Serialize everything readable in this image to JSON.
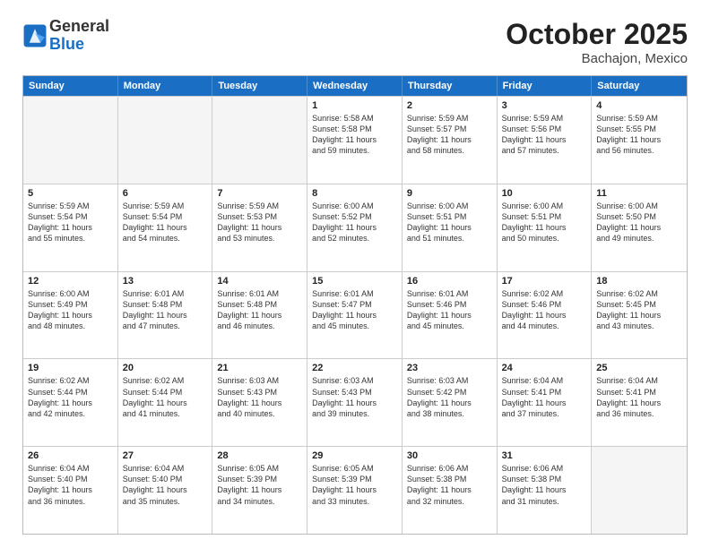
{
  "header": {
    "logo_general": "General",
    "logo_blue": "Blue",
    "month_title": "October 2025",
    "location": "Bachajon, Mexico"
  },
  "weekdays": [
    "Sunday",
    "Monday",
    "Tuesday",
    "Wednesday",
    "Thursday",
    "Friday",
    "Saturday"
  ],
  "rows": [
    [
      {
        "day": "",
        "lines": [],
        "empty": true
      },
      {
        "day": "",
        "lines": [],
        "empty": true
      },
      {
        "day": "",
        "lines": [],
        "empty": true
      },
      {
        "day": "1",
        "lines": [
          "Sunrise: 5:58 AM",
          "Sunset: 5:58 PM",
          "Daylight: 11 hours",
          "and 59 minutes."
        ]
      },
      {
        "day": "2",
        "lines": [
          "Sunrise: 5:59 AM",
          "Sunset: 5:57 PM",
          "Daylight: 11 hours",
          "and 58 minutes."
        ]
      },
      {
        "day": "3",
        "lines": [
          "Sunrise: 5:59 AM",
          "Sunset: 5:56 PM",
          "Daylight: 11 hours",
          "and 57 minutes."
        ]
      },
      {
        "day": "4",
        "lines": [
          "Sunrise: 5:59 AM",
          "Sunset: 5:55 PM",
          "Daylight: 11 hours",
          "and 56 minutes."
        ]
      }
    ],
    [
      {
        "day": "5",
        "lines": [
          "Sunrise: 5:59 AM",
          "Sunset: 5:54 PM",
          "Daylight: 11 hours",
          "and 55 minutes."
        ]
      },
      {
        "day": "6",
        "lines": [
          "Sunrise: 5:59 AM",
          "Sunset: 5:54 PM",
          "Daylight: 11 hours",
          "and 54 minutes."
        ]
      },
      {
        "day": "7",
        "lines": [
          "Sunrise: 5:59 AM",
          "Sunset: 5:53 PM",
          "Daylight: 11 hours",
          "and 53 minutes."
        ]
      },
      {
        "day": "8",
        "lines": [
          "Sunrise: 6:00 AM",
          "Sunset: 5:52 PM",
          "Daylight: 11 hours",
          "and 52 minutes."
        ]
      },
      {
        "day": "9",
        "lines": [
          "Sunrise: 6:00 AM",
          "Sunset: 5:51 PM",
          "Daylight: 11 hours",
          "and 51 minutes."
        ]
      },
      {
        "day": "10",
        "lines": [
          "Sunrise: 6:00 AM",
          "Sunset: 5:51 PM",
          "Daylight: 11 hours",
          "and 50 minutes."
        ]
      },
      {
        "day": "11",
        "lines": [
          "Sunrise: 6:00 AM",
          "Sunset: 5:50 PM",
          "Daylight: 11 hours",
          "and 49 minutes."
        ]
      }
    ],
    [
      {
        "day": "12",
        "lines": [
          "Sunrise: 6:00 AM",
          "Sunset: 5:49 PM",
          "Daylight: 11 hours",
          "and 48 minutes."
        ]
      },
      {
        "day": "13",
        "lines": [
          "Sunrise: 6:01 AM",
          "Sunset: 5:48 PM",
          "Daylight: 11 hours",
          "and 47 minutes."
        ]
      },
      {
        "day": "14",
        "lines": [
          "Sunrise: 6:01 AM",
          "Sunset: 5:48 PM",
          "Daylight: 11 hours",
          "and 46 minutes."
        ]
      },
      {
        "day": "15",
        "lines": [
          "Sunrise: 6:01 AM",
          "Sunset: 5:47 PM",
          "Daylight: 11 hours",
          "and 45 minutes."
        ]
      },
      {
        "day": "16",
        "lines": [
          "Sunrise: 6:01 AM",
          "Sunset: 5:46 PM",
          "Daylight: 11 hours",
          "and 45 minutes."
        ]
      },
      {
        "day": "17",
        "lines": [
          "Sunrise: 6:02 AM",
          "Sunset: 5:46 PM",
          "Daylight: 11 hours",
          "and 44 minutes."
        ]
      },
      {
        "day": "18",
        "lines": [
          "Sunrise: 6:02 AM",
          "Sunset: 5:45 PM",
          "Daylight: 11 hours",
          "and 43 minutes."
        ]
      }
    ],
    [
      {
        "day": "19",
        "lines": [
          "Sunrise: 6:02 AM",
          "Sunset: 5:44 PM",
          "Daylight: 11 hours",
          "and 42 minutes."
        ]
      },
      {
        "day": "20",
        "lines": [
          "Sunrise: 6:02 AM",
          "Sunset: 5:44 PM",
          "Daylight: 11 hours",
          "and 41 minutes."
        ]
      },
      {
        "day": "21",
        "lines": [
          "Sunrise: 6:03 AM",
          "Sunset: 5:43 PM",
          "Daylight: 11 hours",
          "and 40 minutes."
        ]
      },
      {
        "day": "22",
        "lines": [
          "Sunrise: 6:03 AM",
          "Sunset: 5:43 PM",
          "Daylight: 11 hours",
          "and 39 minutes."
        ]
      },
      {
        "day": "23",
        "lines": [
          "Sunrise: 6:03 AM",
          "Sunset: 5:42 PM",
          "Daylight: 11 hours",
          "and 38 minutes."
        ]
      },
      {
        "day": "24",
        "lines": [
          "Sunrise: 6:04 AM",
          "Sunset: 5:41 PM",
          "Daylight: 11 hours",
          "and 37 minutes."
        ]
      },
      {
        "day": "25",
        "lines": [
          "Sunrise: 6:04 AM",
          "Sunset: 5:41 PM",
          "Daylight: 11 hours",
          "and 36 minutes."
        ]
      }
    ],
    [
      {
        "day": "26",
        "lines": [
          "Sunrise: 6:04 AM",
          "Sunset: 5:40 PM",
          "Daylight: 11 hours",
          "and 36 minutes."
        ]
      },
      {
        "day": "27",
        "lines": [
          "Sunrise: 6:04 AM",
          "Sunset: 5:40 PM",
          "Daylight: 11 hours",
          "and 35 minutes."
        ]
      },
      {
        "day": "28",
        "lines": [
          "Sunrise: 6:05 AM",
          "Sunset: 5:39 PM",
          "Daylight: 11 hours",
          "and 34 minutes."
        ]
      },
      {
        "day": "29",
        "lines": [
          "Sunrise: 6:05 AM",
          "Sunset: 5:39 PM",
          "Daylight: 11 hours",
          "and 33 minutes."
        ]
      },
      {
        "day": "30",
        "lines": [
          "Sunrise: 6:06 AM",
          "Sunset: 5:38 PM",
          "Daylight: 11 hours",
          "and 32 minutes."
        ]
      },
      {
        "day": "31",
        "lines": [
          "Sunrise: 6:06 AM",
          "Sunset: 5:38 PM",
          "Daylight: 11 hours",
          "and 31 minutes."
        ]
      },
      {
        "day": "",
        "lines": [],
        "empty": true
      }
    ]
  ]
}
